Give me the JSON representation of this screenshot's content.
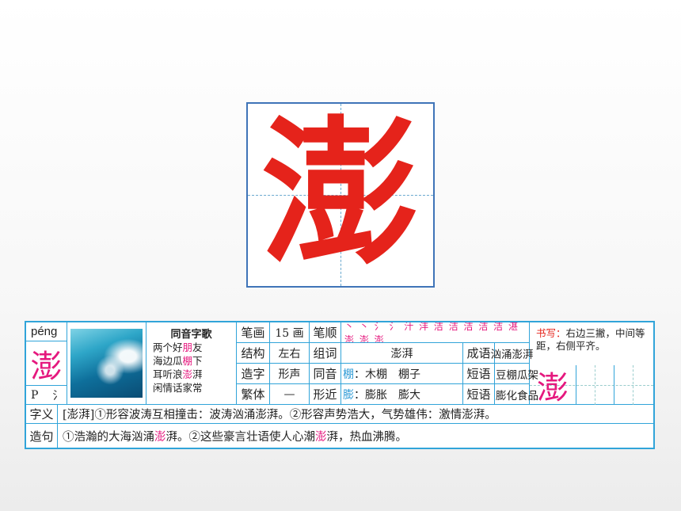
{
  "char": {
    "big": "澎",
    "pinyin": "péng",
    "small": "澎",
    "radical_letter": "P",
    "radical": "氵"
  },
  "song": {
    "title": "同音字歌",
    "lines": [
      "两个好朋友",
      "海边瓜棚下",
      "耳听浪澎湃",
      "闲情话家常"
    ],
    "highlights": [
      "朋",
      "棚",
      "澎"
    ]
  },
  "table": {
    "strokes_label": "笔画",
    "strokes": "15 画",
    "order_label": "笔顺",
    "order": "丶 丶 氵 氵 汁 沣 洁 洁 洁 洁 洁 湛 澎 澎 澎",
    "structure_label": "结构",
    "structure": "左右",
    "words_label": "组词",
    "words": "澎湃",
    "idiom_label": "成语",
    "idiom": "汹涌澎湃",
    "formation_label": "造字",
    "formation": "形声",
    "homophone_label": "同音",
    "homophone_char": "棚",
    "homophone": "：木棚　棚子",
    "phrase_label": "短语",
    "phrase1": "豆棚瓜架",
    "trad_label": "繁体",
    "trad": "—",
    "similar_label": "形近",
    "similar_char": "膨",
    "similar": "：膨胀　膨大",
    "phrase2": "膨化食品"
  },
  "write": {
    "label": "书写：",
    "note": "右边三撇，中间等距，右侧平齐。",
    "char": "澎"
  },
  "meaning": {
    "label": "字义",
    "text": "[澎湃]①形容波涛互相撞击：波涛汹涌澎湃。②形容声势浩大，气势雄伟：激情澎湃。"
  },
  "sentence": {
    "label": "造句",
    "pre": "①浩瀚的大海汹涌",
    "hl1": "澎",
    "mid": "湃。②这些豪言壮语使人心潮",
    "hl2": "澎",
    "post": "湃，热血沸腾。"
  },
  "colors": {
    "red": "#e5231b",
    "pink": "#e5187e",
    "blue": "#31a4d9"
  }
}
